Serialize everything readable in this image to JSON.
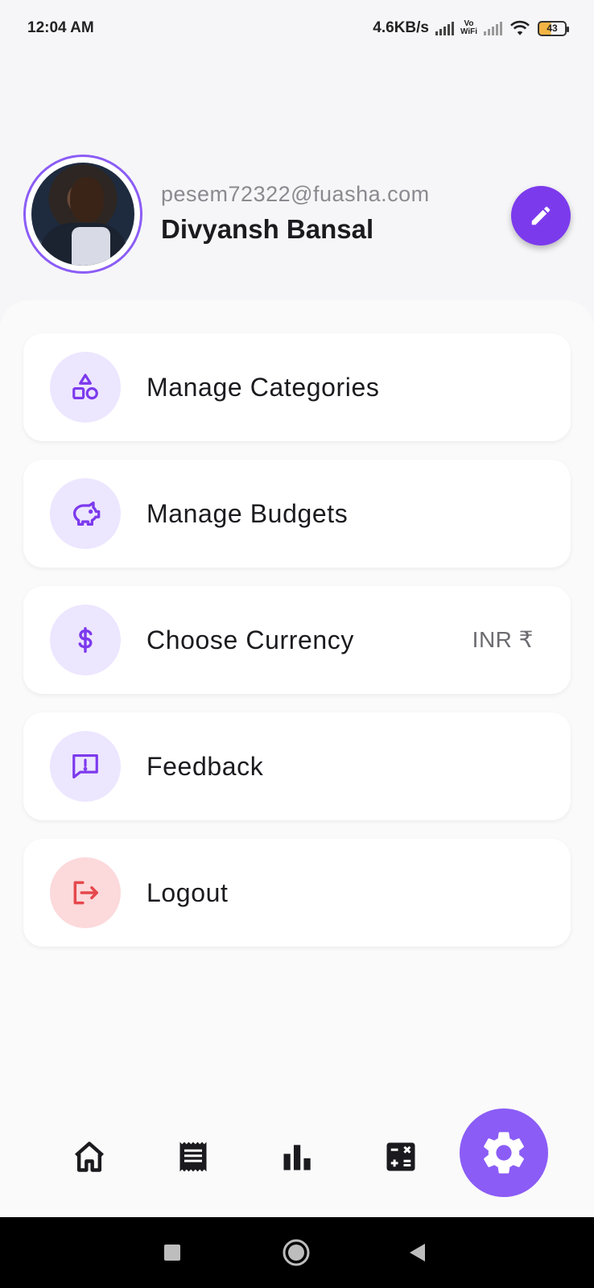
{
  "status_bar": {
    "time": "12:04 AM",
    "net_speed": "4.6KB/s",
    "vowifi_top": "Vo",
    "vowifi_bottom": "WiFi",
    "battery": "43"
  },
  "profile": {
    "email": "pesem72322@fuasha.com",
    "name": "Divyansh Bansal"
  },
  "menu": {
    "items": [
      {
        "label": "Manage Categories",
        "icon": "shapes-icon"
      },
      {
        "label": "Manage Budgets",
        "icon": "piggy-bank-icon"
      },
      {
        "label": "Choose Currency",
        "icon": "dollar-icon",
        "value": "INR ₹"
      },
      {
        "label": "Feedback",
        "icon": "feedback-icon"
      },
      {
        "label": "Logout",
        "icon": "logout-icon"
      }
    ]
  },
  "bottom_nav": {
    "items": [
      "home-icon",
      "receipt-icon",
      "bar-chart-icon",
      "calculator-icon",
      "settings-icon"
    ],
    "active": "settings-icon"
  },
  "colors": {
    "accent": "#8b5cf6",
    "accent_dark": "#7c3aed",
    "icon_bg": "#ede6ff",
    "logout_bg": "#fcd9db",
    "logout_fg": "#e5484d"
  }
}
